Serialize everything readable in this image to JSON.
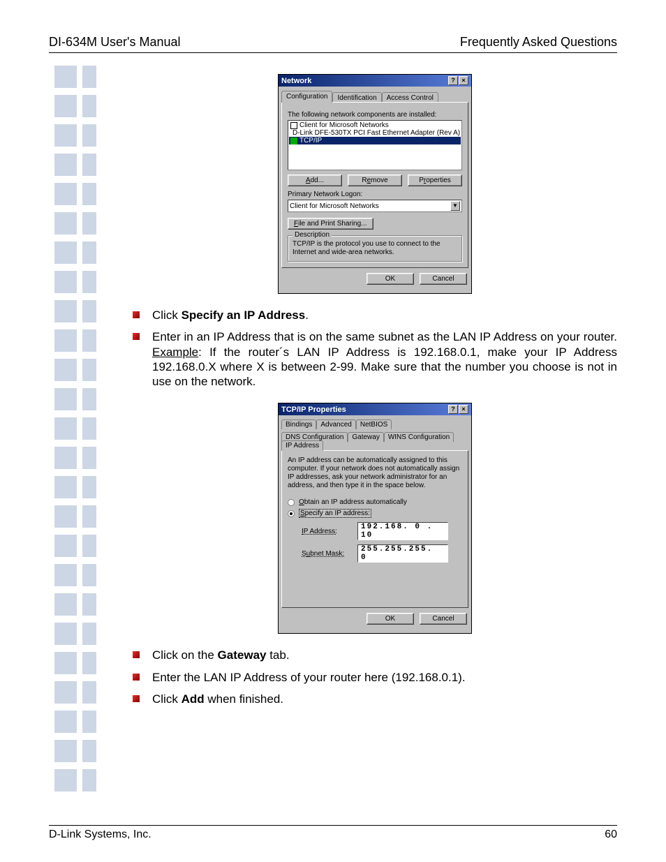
{
  "header": {
    "left": "DI-634M User's Manual",
    "right": "Frequently Asked Questions"
  },
  "footer": {
    "left": "D-Link Systems, Inc.",
    "right": "60"
  },
  "dialog1": {
    "title": "Network",
    "tabs": {
      "t1": "Configuration",
      "t2": "Identification",
      "t3": "Access Control"
    },
    "intro": "The following network components are installed:",
    "items": {
      "a": "Client for Microsoft Networks",
      "b": "D-Link DFE-530TX PCI Fast Ethernet Adapter (Rev A)",
      "c": "TCP/IP"
    },
    "btn_add": "Add...",
    "btn_remove": "Remove",
    "btn_props": "Properties",
    "logon_label": "Primary Network Logon:",
    "logon_value": "Client for Microsoft Networks",
    "btn_fps": "File and Print Sharing...",
    "desc_legend": "Description",
    "desc_text": "TCP/IP is the protocol you use to connect to the Internet and wide-area networks.",
    "btn_ok": "OK",
    "btn_cancel": "Cancel"
  },
  "bullets1": {
    "b1_pre": "Click ",
    "b1_bold": "Specify an IP Address",
    "b1_post": ".",
    "b2_a": "Enter in an IP Address that is on the same subnet as the LAN IP Address on your router. ",
    "b2_ex": "Example",
    "b2_b": ": If the router´s LAN IP Address is 192.168.0.1, make your IP Address 192.168.0.X where X is between 2-99. Make sure that the number you choose is not in use on the network."
  },
  "dialog2": {
    "title": "TCP/IP Properties",
    "tabs_r1": {
      "a": "Bindings",
      "b": "Advanced",
      "c": "NetBIOS"
    },
    "tabs_r2": {
      "a": "DNS Configuration",
      "b": "Gateway",
      "c": "WINS Configuration",
      "d": "IP Address"
    },
    "intro": "An IP address can be automatically assigned to this computer. If your network does not automatically assign IP addresses, ask your network administrator for an address, and then type it in the space below.",
    "radio1": "Obtain an IP address automatically",
    "radio2": "Specify an IP address:",
    "ip_label": "IP Address:",
    "ip_value": "192.168. 0 . 10",
    "mask_label": "Subnet Mask:",
    "mask_value": "255.255.255. 0",
    "btn_ok": "OK",
    "btn_cancel": "Cancel"
  },
  "bullets2": {
    "b1_a": "Click on the ",
    "b1_bold": "Gateway",
    "b1_b": " tab.",
    "b2": "Enter the LAN IP Address of your router here (192.168.0.1).",
    "b3_a": "Click ",
    "b3_bold": "Add",
    "b3_b": " when finished."
  }
}
